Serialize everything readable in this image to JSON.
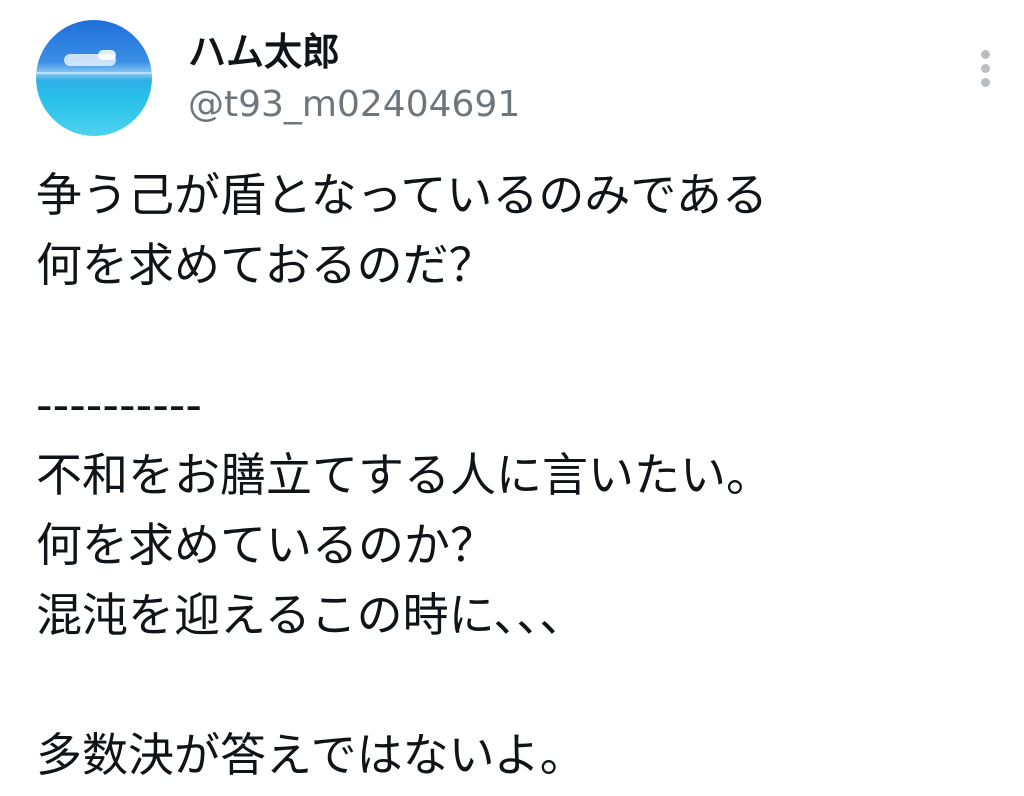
{
  "user": {
    "display_name": "ハム太郎",
    "handle": "@t93_m02404691",
    "avatar_icon": "avatar-image"
  },
  "more_icon": "more-vertical-icon",
  "tweet": {
    "lines": [
      "争う己が盾となっているのみである",
      "何を求めておるのだ？",
      "",
      "----------",
      "不和をお膳立てする人に言いたい。",
      "何を求めているのか？",
      "混沌を迎えるこの時に、、、",
      "",
      "多数決が答えではないよ。"
    ]
  }
}
